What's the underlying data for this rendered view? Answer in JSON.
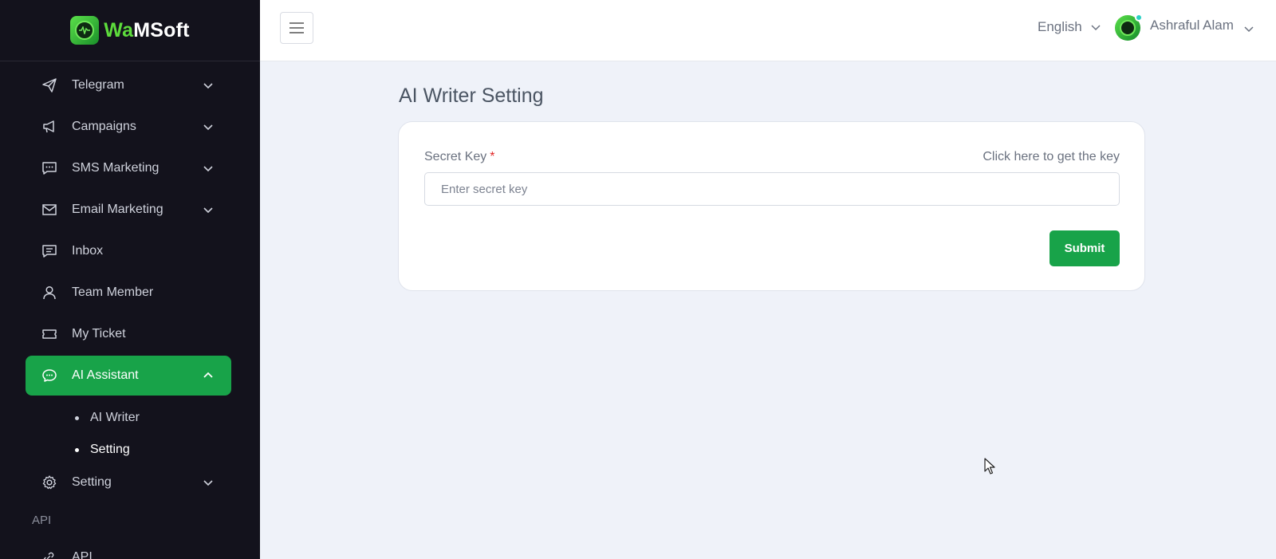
{
  "brand": {
    "wa": "Wa",
    "msoft": "MSoft"
  },
  "sidebar": {
    "items": [
      {
        "label": "Telegram",
        "icon": "send-icon"
      },
      {
        "label": "Campaigns",
        "icon": "megaphone-icon"
      },
      {
        "label": "SMS Marketing",
        "icon": "chat-dots-icon"
      },
      {
        "label": "Email Marketing",
        "icon": "mail-icon"
      },
      {
        "label": "Inbox",
        "icon": "message-icon"
      },
      {
        "label": "Team Member",
        "icon": "user-icon"
      },
      {
        "label": "My Ticket",
        "icon": "ticket-icon"
      },
      {
        "label": "AI Assistant",
        "icon": "ai-chat-icon"
      }
    ],
    "ai_sub": [
      {
        "label": "AI Writer"
      },
      {
        "label": "Setting"
      }
    ],
    "setting": {
      "label": "Setting",
      "icon": "gear-icon"
    },
    "section_api": "API",
    "api_item": {
      "label": "API",
      "icon": "link-icon"
    }
  },
  "header": {
    "language": "English",
    "user_name": "Ashraful Alam"
  },
  "main": {
    "title": "AI Writer Setting",
    "field_label": "Secret Key",
    "required_mark": "*",
    "key_link": "Click here to get the key",
    "input_placeholder": "Enter secret key",
    "input_value": "",
    "submit_label": "Submit"
  },
  "colors": {
    "sidebar_bg": "#13121c",
    "accent": "#18a349",
    "page_bg": "#eff2f9"
  }
}
